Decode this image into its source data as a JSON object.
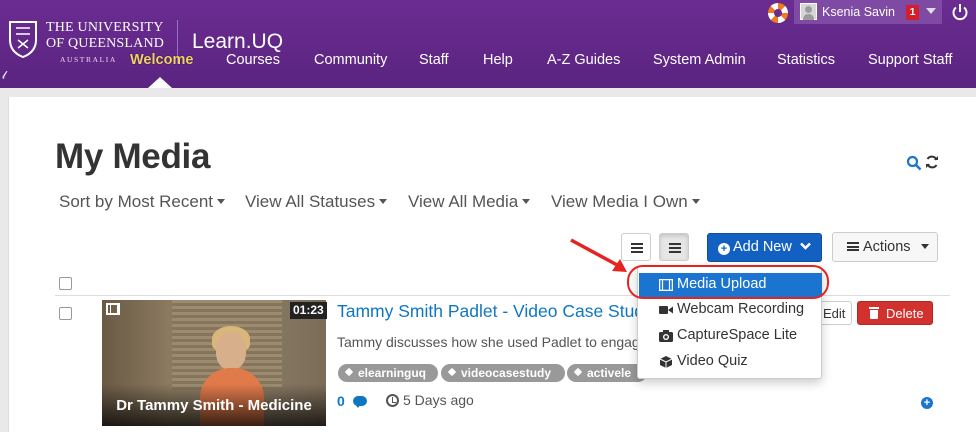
{
  "header": {
    "logo": {
      "line1": "The University",
      "line2": "of Queensland",
      "line3": "AUSTRALIA"
    },
    "brand": "Learn.UQ",
    "nav": [
      {
        "label": "Welcome",
        "active": true
      },
      {
        "label": "Courses"
      },
      {
        "label": "Community"
      },
      {
        "label": "Staff"
      },
      {
        "label": "Help"
      },
      {
        "label": "A-Z Guides"
      },
      {
        "label": "System Admin"
      },
      {
        "label": "Statistics"
      },
      {
        "label": "Support Staff"
      }
    ],
    "user": {
      "name": "Ksenia Savin",
      "notifications": "1"
    },
    "colors": {
      "header_bg": "#6a2c91",
      "active_nav": "#f2d26b"
    }
  },
  "page": {
    "title": "My Media",
    "filters": [
      "Sort by Most Recent",
      "View All Statuses",
      "View All Media",
      "View Media I Own"
    ]
  },
  "toolbar": {
    "add_new_label": "Add New",
    "actions_label": "Actions"
  },
  "add_new_menu": {
    "items": [
      {
        "label": "Media Upload",
        "icon": "film-icon",
        "highlighted": true
      },
      {
        "label": "Webcam Recording",
        "icon": "video-camera-icon"
      },
      {
        "label": "CaptureSpace Lite",
        "icon": "camera-icon"
      },
      {
        "label": "Video Quiz",
        "icon": "cube-icon"
      }
    ]
  },
  "media_list": [
    {
      "title": "Tammy Smith Padlet - Video Case Stud",
      "description": "Tammy discusses how she used Padlet to engag",
      "thumbnail_caption": "Dr Tammy Smith - Medicine",
      "duration": "01:23",
      "tags": [
        "elearninguq",
        "videocasestudy",
        "activele"
      ],
      "likes": "0",
      "age": "5 Days ago",
      "edit_label": "Edit",
      "delete_label": "Delete"
    }
  ]
}
